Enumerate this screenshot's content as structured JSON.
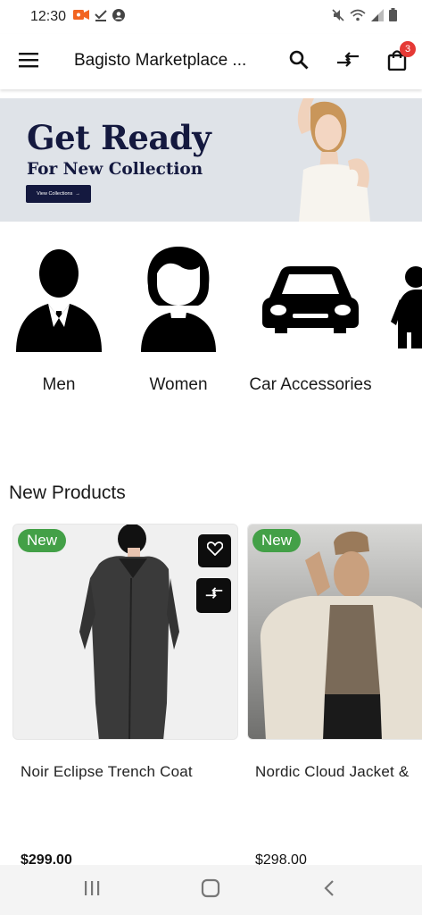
{
  "status_bar": {
    "time": "12:30"
  },
  "app_bar": {
    "title": "Bagisto Marketplace ...",
    "cart_count": "3"
  },
  "banner": {
    "headline": "Get Ready",
    "subheadline": "For New Collection",
    "button_label": "View Collections",
    "button_arrow": "→"
  },
  "categories": [
    {
      "label": "Men",
      "icon": "man-silhouette-icon"
    },
    {
      "label": "Women",
      "icon": "woman-silhouette-icon"
    },
    {
      "label": "Car Accessories",
      "icon": "car-icon"
    }
  ],
  "new_products": {
    "title": "New Products",
    "items": [
      {
        "badge": "New",
        "name": "Noir Eclipse Trench Coat",
        "price": "$299.00"
      },
      {
        "badge": "New",
        "name": "Nordic Cloud Jacket &",
        "price": "$298.00"
      }
    ]
  },
  "colors": {
    "accent_dark": "#14193f",
    "badge_green": "#43a047",
    "cart_badge": "#e53935"
  }
}
